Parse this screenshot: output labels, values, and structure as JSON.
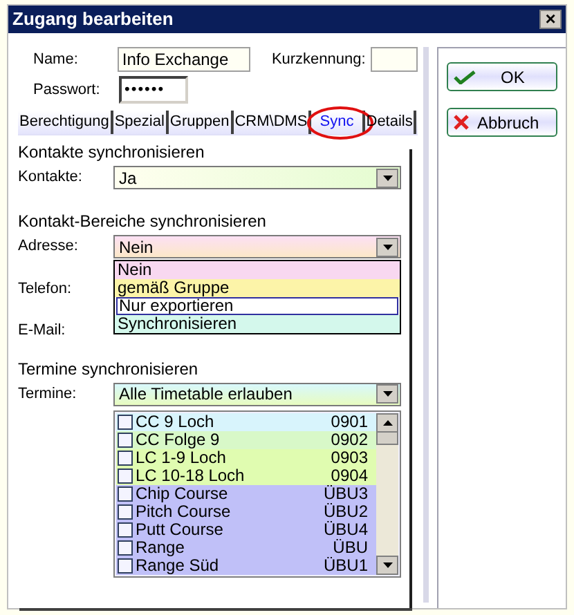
{
  "window": {
    "title": "Zugang bearbeiten",
    "close": "×"
  },
  "fields": {
    "name_label": "Name:",
    "name_value": "Info Exchange",
    "short_label": "Kurzkennung:",
    "password_label": "Passwort:",
    "password_value": "••••••"
  },
  "tabs": [
    {
      "label": "Berechtigung",
      "selected": false
    },
    {
      "label": "Spezial",
      "selected": false
    },
    {
      "label": "Gruppen",
      "selected": false
    },
    {
      "label": "CRM\\DMS",
      "selected": false
    },
    {
      "label": "Sync",
      "selected": true,
      "highlighted": true
    },
    {
      "label": "Details",
      "selected": false
    }
  ],
  "contacts": {
    "heading": "Kontakte synchronisieren",
    "label": "Kontakte:",
    "value": "Ja"
  },
  "areas": {
    "heading": "Kontakt-Bereiche synchronisieren",
    "address_label": "Adresse:",
    "address_value": "Nein",
    "phone_label": "Telefon:",
    "email_label": "E-Mail:",
    "options": [
      {
        "label": "Nein",
        "color": "#f8d8f0",
        "selected": false
      },
      {
        "label": "gemäß Gruppe",
        "color": "#fcf4a8",
        "selected": false
      },
      {
        "label": "Nur exportieren",
        "color": "#ffffff",
        "selected": true
      },
      {
        "label": "Synchronisieren",
        "color": "#d4f8ec",
        "selected": false
      }
    ]
  },
  "appointments": {
    "heading": "Termine synchronisieren",
    "label": "Termine:",
    "value": "Alle Timetable erlauben",
    "rows": [
      {
        "name": "CC 9 Loch",
        "code": "0901",
        "checked": false,
        "color": "#d8f4fc"
      },
      {
        "name": "CC Folge 9",
        "code": "0902",
        "checked": false,
        "color": "#d8f8c8"
      },
      {
        "name": "LC 1-9 Loch",
        "code": "0903",
        "checked": false,
        "color": "#e0fcb0"
      },
      {
        "name": "LC 10-18 Loch",
        "code": "0904",
        "checked": false,
        "color": "#e0fcb0"
      },
      {
        "name": "Chip Course",
        "code": "ÜBU3",
        "checked": false,
        "color": "#c0c0f8"
      },
      {
        "name": "Pitch Course",
        "code": "ÜBU2",
        "checked": false,
        "color": "#c0c0f8"
      },
      {
        "name": "Putt Course",
        "code": "ÜBU4",
        "checked": false,
        "color": "#c0c0f8"
      },
      {
        "name": "Range",
        "code": "ÜBU",
        "checked": false,
        "color": "#c0c0f8"
      },
      {
        "name": "Range Süd",
        "code": "ÜBU1",
        "checked": false,
        "color": "#c0c0f8"
      }
    ]
  },
  "buttons": [
    {
      "kind": "ok",
      "label": "OK"
    },
    {
      "kind": "cancel",
      "label": "Abbruch"
    }
  ]
}
